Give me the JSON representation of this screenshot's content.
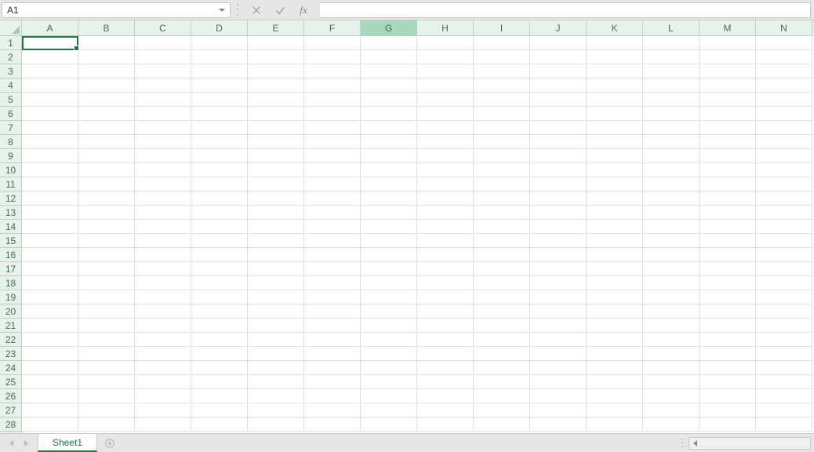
{
  "formula_bar": {
    "name_box_value": "A1",
    "fx_label": "fx",
    "formula_value": ""
  },
  "columns": [
    "A",
    "B",
    "C",
    "D",
    "E",
    "F",
    "G",
    "H",
    "I",
    "J",
    "K",
    "L",
    "M",
    "N"
  ],
  "rows": [
    1,
    2,
    3,
    4,
    5,
    6,
    7,
    8,
    9,
    10,
    11,
    12,
    13,
    14,
    15,
    16,
    17,
    18,
    19,
    20,
    21,
    22,
    23,
    24,
    25,
    26,
    27,
    28
  ],
  "hovered_column": "G",
  "active_cell": "A1",
  "sheet_tabs": {
    "active": "Sheet1"
  },
  "colors": {
    "accent": "#1b7a43",
    "header_bg": "#e8f2ec"
  }
}
